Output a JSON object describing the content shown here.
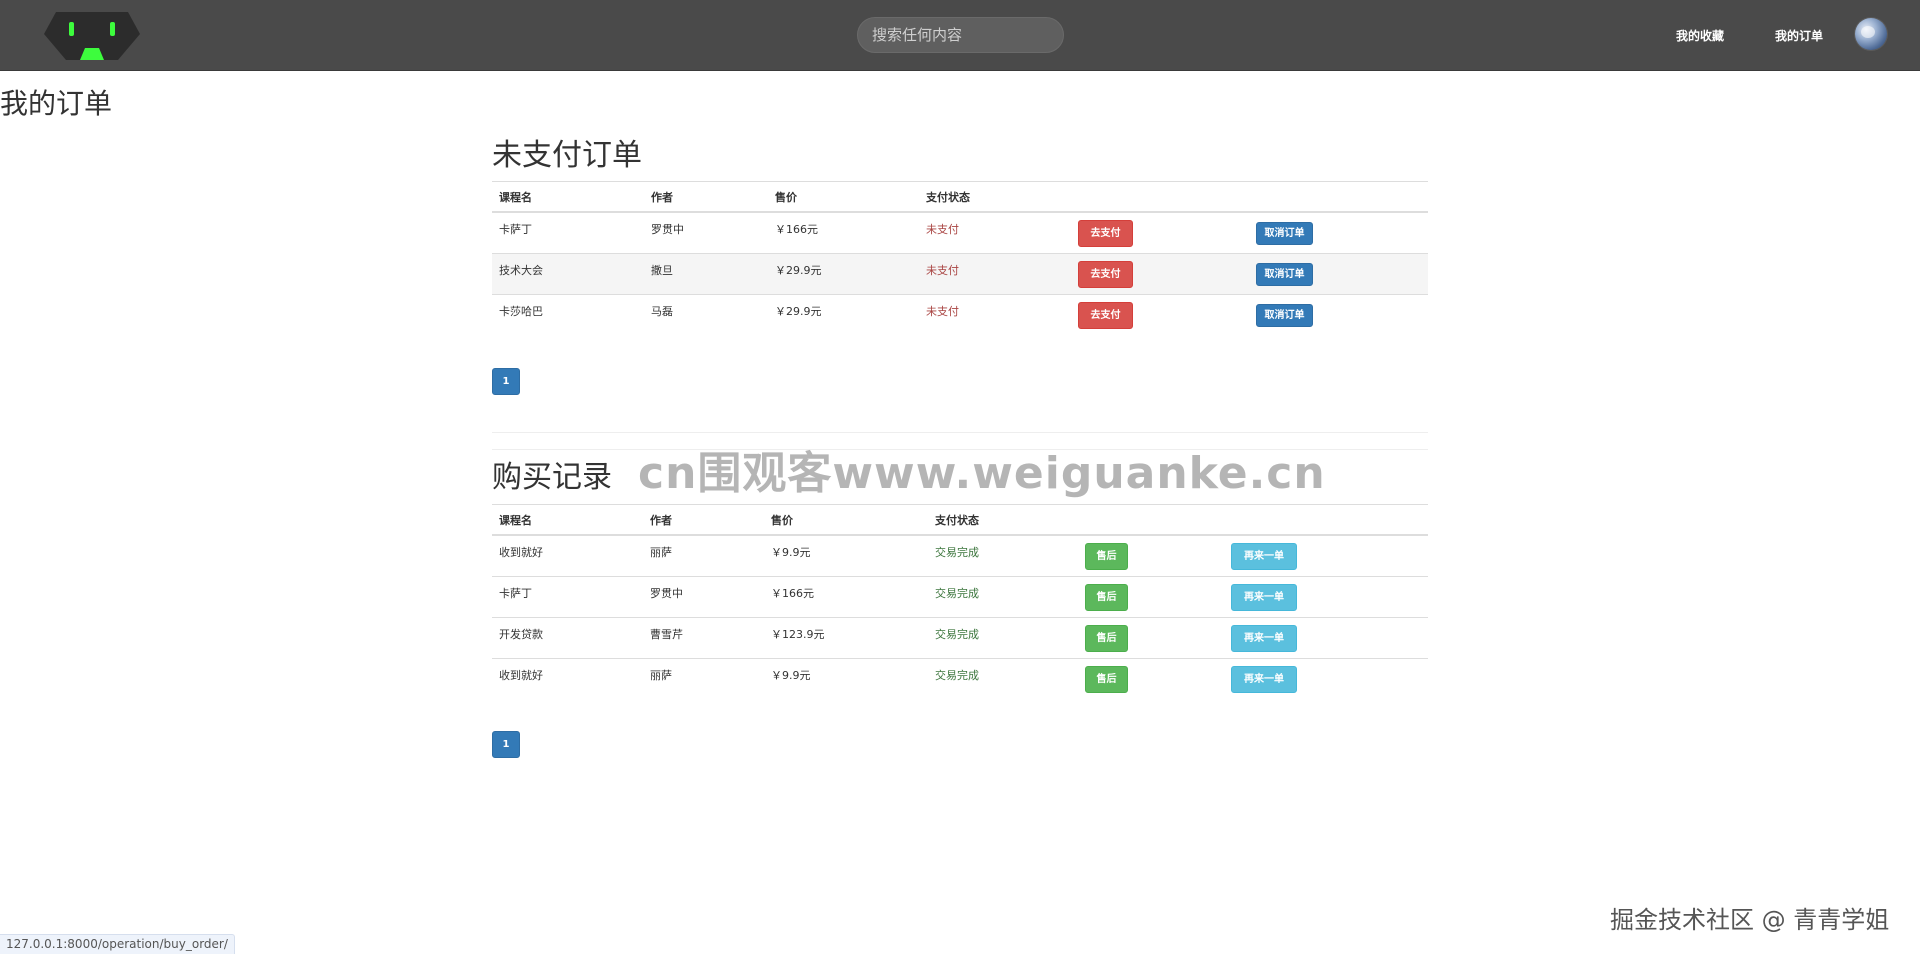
{
  "header": {
    "search_placeholder": "搜索任何内容",
    "nav": {
      "favorites": "我的收藏",
      "orders": "我的订单"
    }
  },
  "page_title": "我的订单",
  "unpaid": {
    "title": "未支付订单",
    "columns": [
      "课程名",
      "作者",
      "售价",
      "支付状态"
    ],
    "rows": [
      {
        "course": "卡萨丁",
        "author": "罗贯中",
        "price": "￥166元",
        "status": "未支付",
        "pay": "去支付",
        "cancel": "取消订单"
      },
      {
        "course": "技术大会",
        "author": "撒旦",
        "price": "￥29.9元",
        "status": "未支付",
        "pay": "去支付",
        "cancel": "取消订单"
      },
      {
        "course": "卡莎哈巴",
        "author": "马磊",
        "price": "￥29.9元",
        "status": "未支付",
        "pay": "去支付",
        "cancel": "取消订单"
      }
    ],
    "page": "1"
  },
  "history": {
    "title": "购买记录",
    "columns": [
      "课程名",
      "作者",
      "售价",
      "支付状态"
    ],
    "rows": [
      {
        "course": "收到就好",
        "author": "丽萨",
        "price": "￥9.9元",
        "status": "交易完成",
        "after_sale": "售后",
        "reorder": "再来一单"
      },
      {
        "course": "卡萨丁",
        "author": "罗贯中",
        "price": "￥166元",
        "status": "交易完成",
        "after_sale": "售后",
        "reorder": "再来一单"
      },
      {
        "course": "开发贷款",
        "author": "曹雪芹",
        "price": "￥123.9元",
        "status": "交易完成",
        "after_sale": "售后",
        "reorder": "再来一单"
      },
      {
        "course": "收到就好",
        "author": "丽萨",
        "price": "￥9.9元",
        "status": "交易完成",
        "after_sale": "售后",
        "reorder": "再来一单"
      }
    ],
    "page": "1"
  },
  "watermark": "cn围观客www.weiguanke.cn",
  "credit": "掘金技术社区 @ 青青学姐",
  "status_url": "127.0.0.1:8000/operation/buy_order/",
  "colors": {
    "topbar": "#4a4a4a",
    "danger": "#d9534f",
    "primary": "#337ab7",
    "success": "#5cb85c",
    "info": "#5bc0de",
    "unpaid_text": "#a94442",
    "done_text": "#3c763d"
  }
}
